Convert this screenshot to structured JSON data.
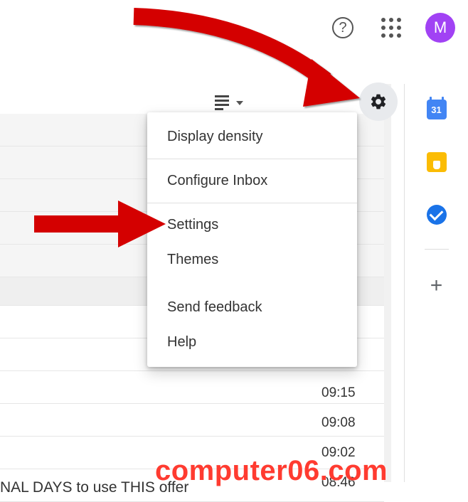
{
  "topbar": {
    "help_tooltip": "?",
    "avatar_initial": "M"
  },
  "gear": {
    "label": "Settings"
  },
  "menu": {
    "items": [
      {
        "label": "Display density"
      },
      {
        "label": "Configure Inbox"
      },
      {
        "label": "Settings"
      },
      {
        "label": "Themes"
      },
      {
        "label": "Send feedback"
      },
      {
        "label": "Help"
      }
    ]
  },
  "timestamps": [
    "09:15",
    "09:08",
    "09:02",
    "08:46"
  ],
  "sidepanel": {
    "calendar_day": "31",
    "plus": "+"
  },
  "partial_row_text": "NAL DAYS to use THIS offer",
  "watermark": "computer06.com"
}
